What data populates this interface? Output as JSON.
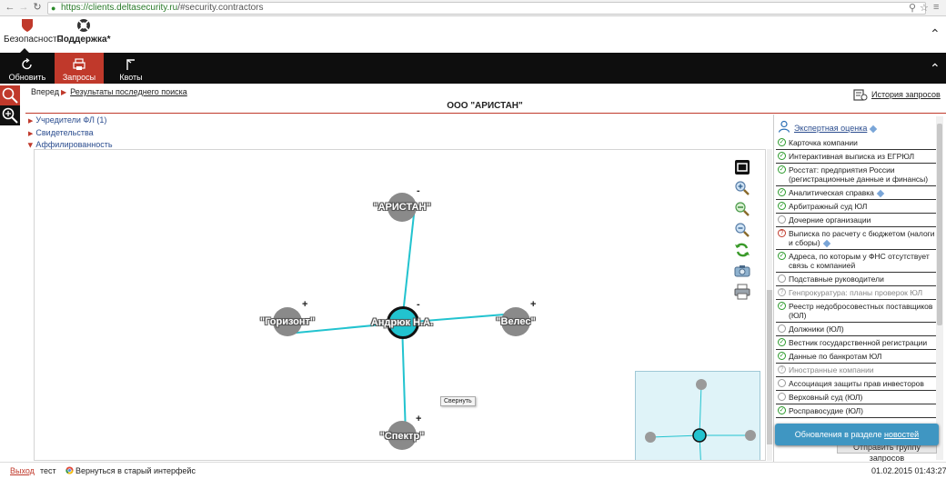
{
  "browser": {
    "url_host": "https://clients.deltasecurity.ru",
    "url_path": "/#security.contractors"
  },
  "app_tabs": {
    "security": "Безопасность",
    "support": "Поддержка*"
  },
  "toolbar": {
    "refresh": "Обновить",
    "requests": "Запросы",
    "quotas": "Квоты"
  },
  "breadcrumb": {
    "forward": "Вперед",
    "last_search": "Результаты последнего поиска"
  },
  "history_link": "История запросов",
  "page_title": "ООО \"АРИСТАН\"",
  "tree": {
    "founders": "Учредители ФЛ (1)",
    "certificates": "Свидетельства",
    "affiliation": "Аффилированность"
  },
  "graph": {
    "nodes": {
      "aristan": "\"АРИСТАН\"",
      "andryuk": "Андрюк Н.А.",
      "gorizont": "\"Горизонт\"",
      "veles": "\"Велес\"",
      "spektr": "\"Спектр\""
    },
    "signs": {
      "minus": "-",
      "plus": "+"
    },
    "tooltip": "Свернуть"
  },
  "right_panel": {
    "expert": "Экспертная оценка",
    "items": [
      {
        "label": "Карточка компании",
        "status": "ok"
      },
      {
        "label": "Интерактивная выписка из ЕГРЮЛ",
        "status": "ok"
      },
      {
        "label": "Росстат: предприятия России (регистрационные данные и финансы)",
        "status": "ok"
      },
      {
        "label": "Аналитическая справка",
        "status": "ok"
      },
      {
        "label": "Арбитражный суд ЮЛ",
        "status": "ok"
      },
      {
        "label": "Дочерние организации",
        "status": "empty"
      },
      {
        "label": "Выписка по расчету с бюджетом (налоги и сборы)",
        "status": "q"
      },
      {
        "label": "Адреса, по которым у ФНС отсутствует связь с компанией",
        "status": "ok"
      },
      {
        "label": "Подставные руководители",
        "status": "empty"
      },
      {
        "label": "Генпрокуратура: планы проверок ЮЛ",
        "status": "qg"
      },
      {
        "label": "Реестр недобросовестных поставщиков (ЮЛ)",
        "status": "ok"
      },
      {
        "label": "Должники (ЮЛ)",
        "status": "empty"
      },
      {
        "label": "Вестник государственной регистрации",
        "status": "ok"
      },
      {
        "label": "Данные по банкротам ЮЛ",
        "status": "ok"
      },
      {
        "label": "Иностранные компании",
        "status": "qg"
      },
      {
        "label": "Ассоциация защиты прав инвесторов",
        "status": "empty"
      },
      {
        "label": "Верховный суд (ЮЛ)",
        "status": "empty"
      },
      {
        "label": "Росправосудие (ЮЛ)",
        "status": "ok"
      }
    ],
    "send_group": "Отправить группу запросов",
    "news_toast_prefix": "Обновления в разделе ",
    "news_toast_link": "новостей"
  },
  "footer": {
    "logout": "Выход",
    "user": "тест",
    "old_ui": "Вернуться в старый интерфейс",
    "datetime": "01.02.2015 01:43:27"
  },
  "colors": {
    "accent_red": "#c0392b",
    "edge_cyan": "#22c3cf",
    "node_grey": "#8a8a8a",
    "toolbar_black": "#0e0e0e",
    "link_blue": "#2b4d8f",
    "toast_blue": "#3f96c2"
  }
}
